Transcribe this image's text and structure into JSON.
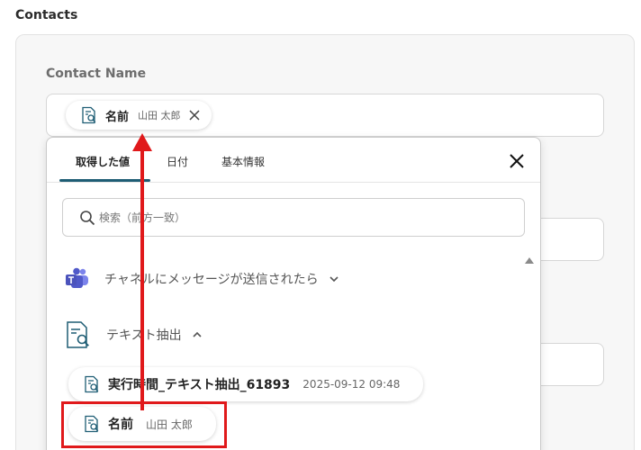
{
  "section": {
    "title": "Contacts"
  },
  "field": {
    "label": "Contact Name",
    "chip": {
      "name": "名前",
      "value": "山田 太郎",
      "icon": "doc-search-icon"
    }
  },
  "dropdown": {
    "tabs": [
      {
        "label": "取得した値",
        "active": true
      },
      {
        "label": "日付",
        "active": false
      },
      {
        "label": "基本情報",
        "active": false
      }
    ],
    "search": {
      "placeholder": "検索（前方一致）",
      "value": ""
    },
    "groups": [
      {
        "label": "チャネルにメッセージが送信されたら",
        "icon": "teams-icon",
        "expanded": false
      },
      {
        "label": "テキスト抽出",
        "icon": "doc-search-icon",
        "expanded": true
      }
    ],
    "items": [
      {
        "name": "実行時間_テキスト抽出_61893",
        "value": "2025-09-12 09:48"
      },
      {
        "name": "名前",
        "value": "山田 太郎"
      }
    ]
  },
  "colors": {
    "accent_tab": "#1e5d74",
    "highlight": "#e0191b",
    "teams": "#5059c9"
  }
}
